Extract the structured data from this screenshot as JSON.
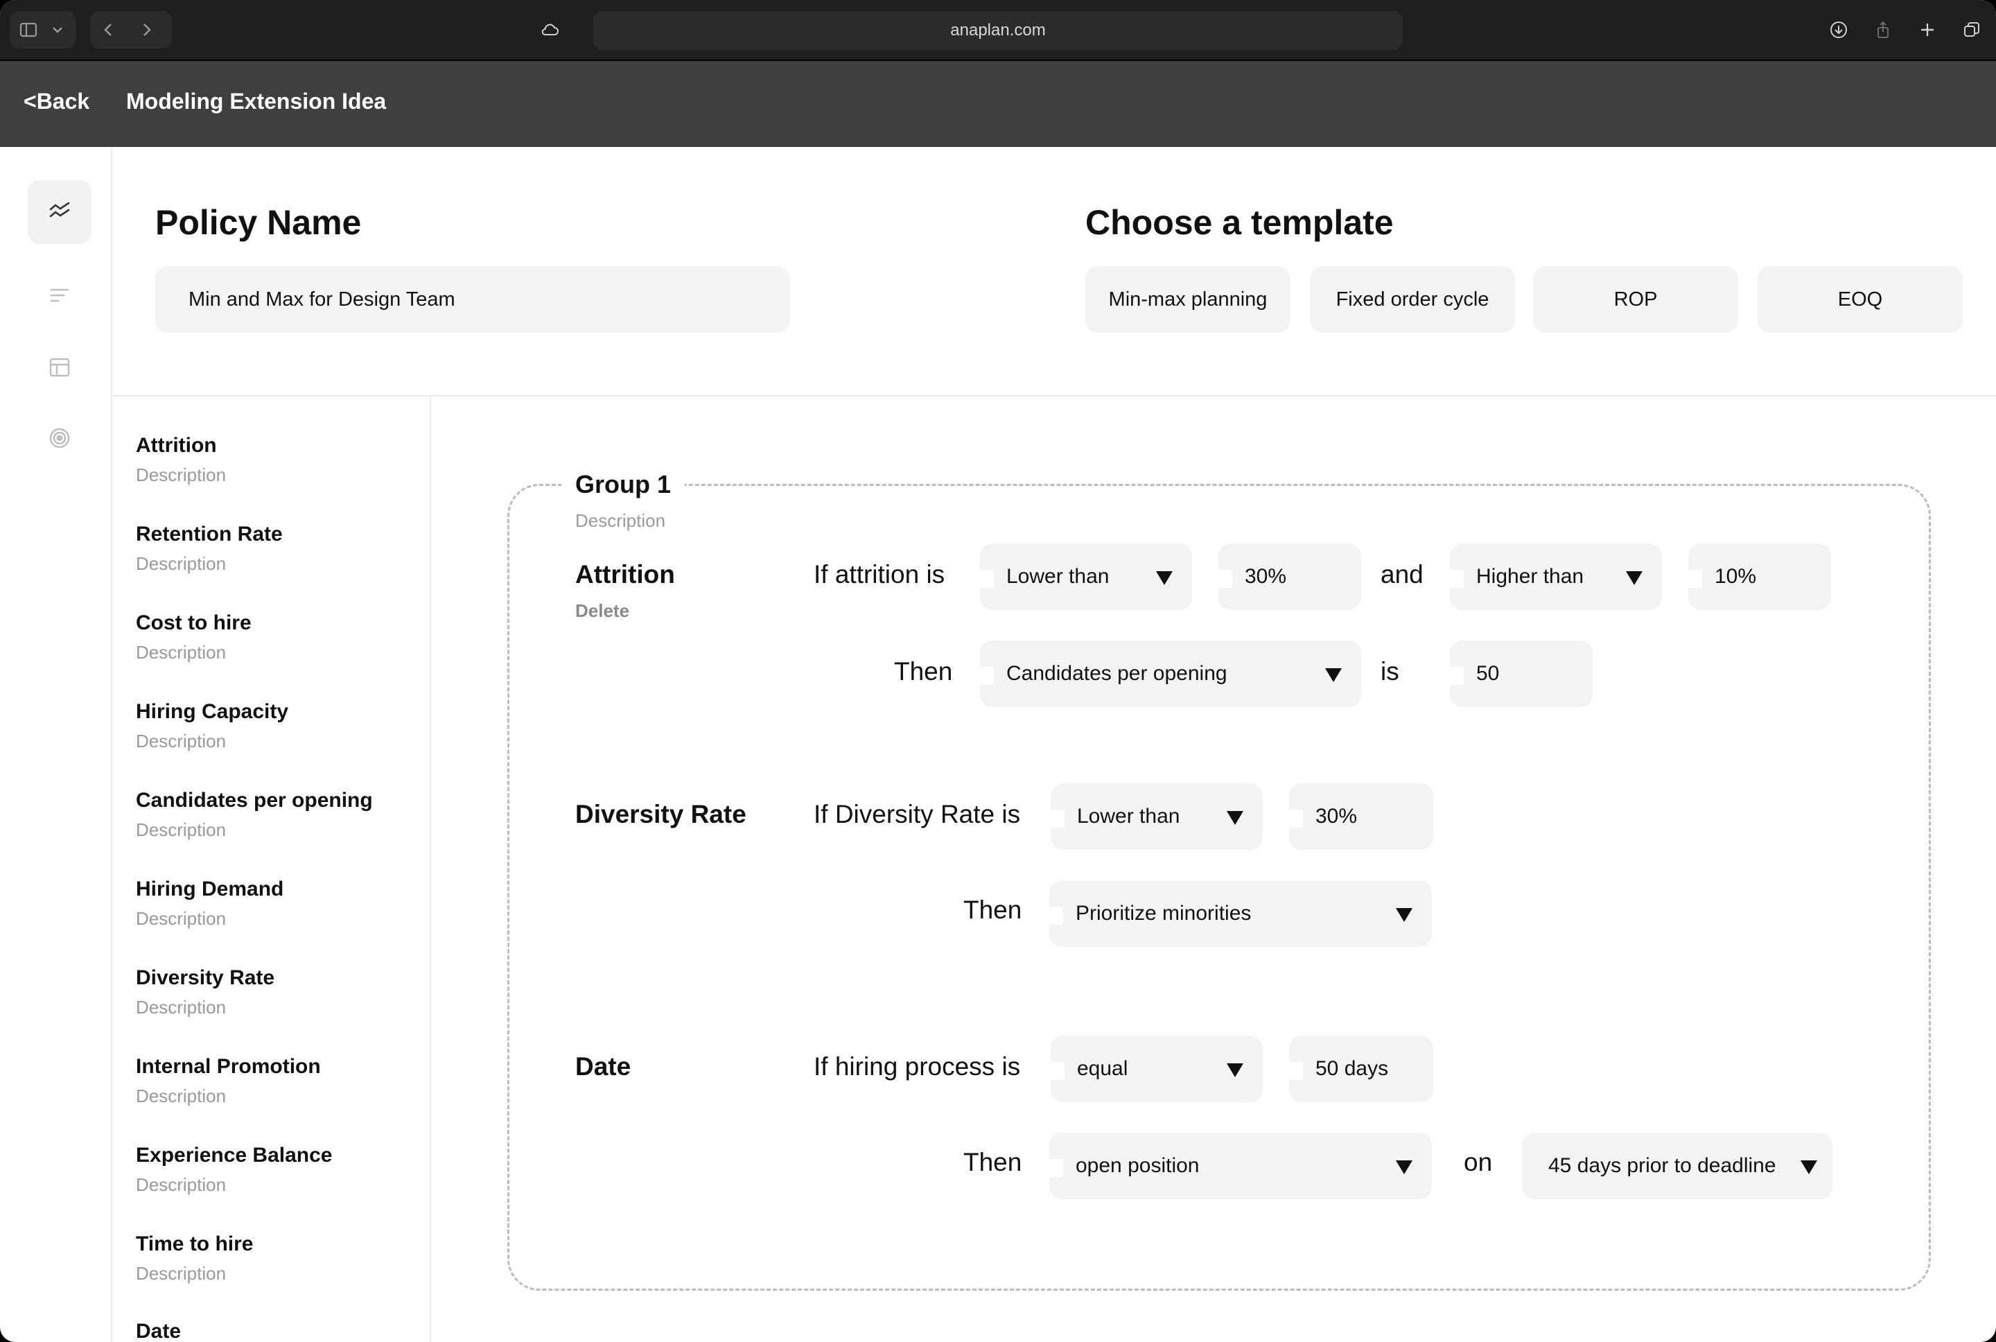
{
  "browser": {
    "url": "anaplan.com"
  },
  "header": {
    "back_label": "<Back",
    "title": "Modeling Extension Idea"
  },
  "policy": {
    "heading": "Policy Name",
    "value": "Min and Max for Design Team"
  },
  "templates": {
    "heading": "Choose a template",
    "items": [
      "Min-max planning",
      "Fixed order cycle",
      "ROP",
      "EOQ"
    ]
  },
  "metrics": [
    {
      "title": "Attrition",
      "desc": "Description"
    },
    {
      "title": "Retention Rate",
      "desc": "Description"
    },
    {
      "title": "Cost to hire",
      "desc": "Description"
    },
    {
      "title": "Hiring Capacity",
      "desc": "Description"
    },
    {
      "title": "Candidates per opening",
      "desc": "Description"
    },
    {
      "title": "Hiring Demand",
      "desc": "Description"
    },
    {
      "title": "Diversity Rate",
      "desc": "Description"
    },
    {
      "title": "Internal Promotion",
      "desc": "Description"
    },
    {
      "title": "Experience Balance",
      "desc": "Description"
    },
    {
      "title": "Time to hire",
      "desc": "Description"
    },
    {
      "title": "Date",
      "desc": ""
    }
  ],
  "group": {
    "title": "Group 1",
    "desc": "Description",
    "rules": {
      "attrition": {
        "title": "Attrition",
        "delete_label": "Delete",
        "if_label": "If attrition is",
        "cond1": "Lower than",
        "val1": "30%",
        "and_label": "and",
        "cond2": "Higher than",
        "val2": "10%",
        "then_label": "Then",
        "action": "Candidates per opening",
        "is_label": "is",
        "action_value": "50"
      },
      "diversity": {
        "title": "Diversity Rate",
        "if_label": "If Diversity Rate is",
        "cond": "Lower than",
        "val": "30%",
        "then_label": "Then",
        "action": "Prioritize minorities"
      },
      "date": {
        "title": "Date",
        "if_label": "If hiring process is",
        "cond": "equal",
        "val": "50 days",
        "then_label": "Then",
        "action": "open position",
        "on_label": "on",
        "timing": "45 days prior to deadline"
      }
    }
  }
}
